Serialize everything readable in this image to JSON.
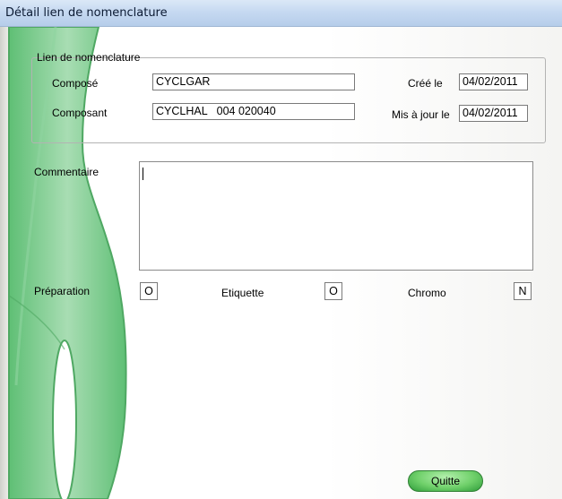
{
  "window": {
    "title": "Détail lien de nomenclature"
  },
  "group": {
    "legend": "Lien de nomenclature",
    "compose_label": "Composé",
    "compose_value": "CYCLGAR",
    "composant_label": "Composant",
    "composant_value": "CYCLHAL   004 020040",
    "cree_label": "Créé le",
    "cree_value": "04/02/2011",
    "maj_label": "Mis à jour le",
    "maj_value": "04/02/2011"
  },
  "commentaire": {
    "label": "Commentaire",
    "value": ""
  },
  "flags": {
    "preparation_label": "Préparation",
    "preparation_value": "O",
    "etiquette_label": "Etiquette",
    "etiquette_value": "O",
    "chromo_label": "Chromo",
    "chromo_value": "N"
  },
  "buttons": {
    "quitte": "Quitte"
  },
  "colors": {
    "accent_green": "#6fd06a",
    "titlebar": "#c6d9f1"
  }
}
